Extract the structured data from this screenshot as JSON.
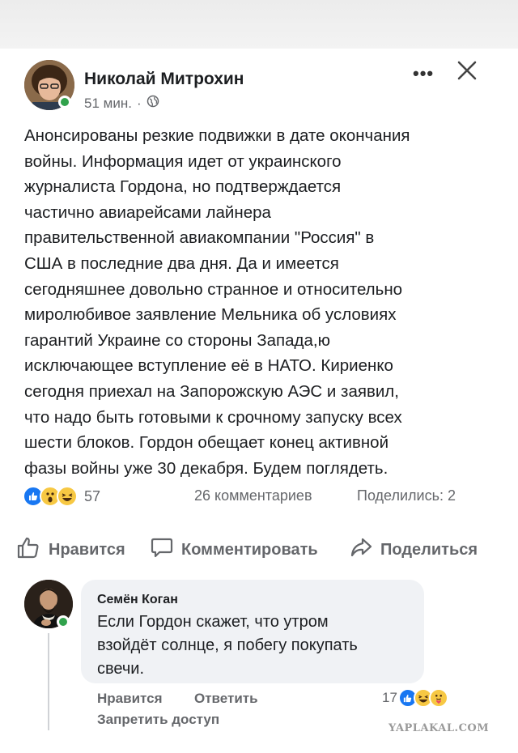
{
  "post": {
    "author": "Николай Митрохин",
    "time": "51 мин.",
    "dot": "·",
    "text_lines": [
      "Анонсированы резкие подвижки в дате окончания",
      "войны. Информация идет от украинского",
      "журналиста Гордона, но подтверждается",
      "частично авиарейсами лайнера",
      "правительственной авиакомпании \"Россия\" в",
      "США в последние два дня. Да и имеется",
      "сегодняшнее довольно странное и относительно",
      "миролюбивое заявление Мельника об условиях",
      "гарантий Украине со стороны Запада,ю",
      "исключающее вступление её в НАТО. Кириенко",
      "сегодня приехал на Запорожскую АЭС и заявил,",
      "что надо быть готовыми к срочному запуску всех",
      "шести блоков. Гордон обещает конец активной",
      "фазы войны уже 30 декабря. Будем поглядеть."
    ],
    "reactions_count": "57",
    "comments_count": "26 комментариев",
    "shares_count": "Поделились: 2",
    "more_icon": "•••"
  },
  "actions": {
    "like": "Нравится",
    "comment": "Комментировать",
    "share": "Поделиться"
  },
  "comment": {
    "author": "Семён Коган",
    "text_lines": [
      "Если Гордон скажет, что утром",
      "взойдёт солнце, я побегу покупать",
      "свечи."
    ],
    "like": "Нравится",
    "reply": "Ответить",
    "reactions_count": "17",
    "block": "Запретить доступ"
  },
  "watermark": "YAPLAKAL.COM",
  "colors": {
    "accent": "#1877f2",
    "online": "#31a24c",
    "muted": "#65676b",
    "bubble": "#f0f2f5"
  }
}
